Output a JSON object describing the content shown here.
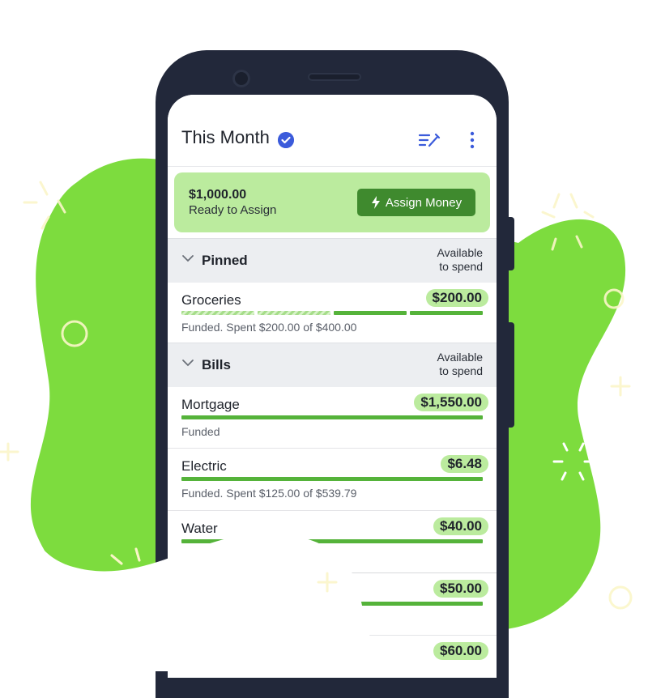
{
  "header": {
    "title": "This Month",
    "check_icon": "check-circle-icon",
    "edit_icon": "edit-list-icon",
    "more_icon": "more-vertical-icon"
  },
  "assign": {
    "amount": "$1,000.00",
    "label": "Ready to Assign",
    "button_label": "Assign Money"
  },
  "groups": [
    {
      "name": "Pinned",
      "available_line1": "Available",
      "available_line2": "to spend"
    },
    {
      "name": "Bills",
      "available_line1": "Available",
      "available_line2": "to spend"
    }
  ],
  "categories": [
    {
      "name": "Groceries",
      "amount": "$200.00",
      "status": "Funded. Spent $200.00 of $400.00",
      "progress": 0.5
    },
    {
      "name": "Mortgage",
      "amount": "$1,550.00",
      "status": "Funded",
      "progress": 1.0
    },
    {
      "name": "Electric",
      "amount": "$6.48",
      "status": "Funded. Spent $125.00 of $539.79",
      "progress": 1.0
    },
    {
      "name": "Water",
      "amount": "$40.00",
      "status": "",
      "progress": 1.0
    },
    {
      "name": "",
      "amount": "$50.00",
      "status": "",
      "progress": 1.0
    },
    {
      "name": "",
      "amount": "$60.00",
      "status": "",
      "progress": 1.0
    }
  ],
  "colors": {
    "accent_green": "#55b33a",
    "button_green": "#3f8a2e",
    "card_green": "#bbeb9e",
    "blob_green": "#7ddc3e",
    "check_blue": "#3b5bdb",
    "phone_frame": "#22283a"
  }
}
